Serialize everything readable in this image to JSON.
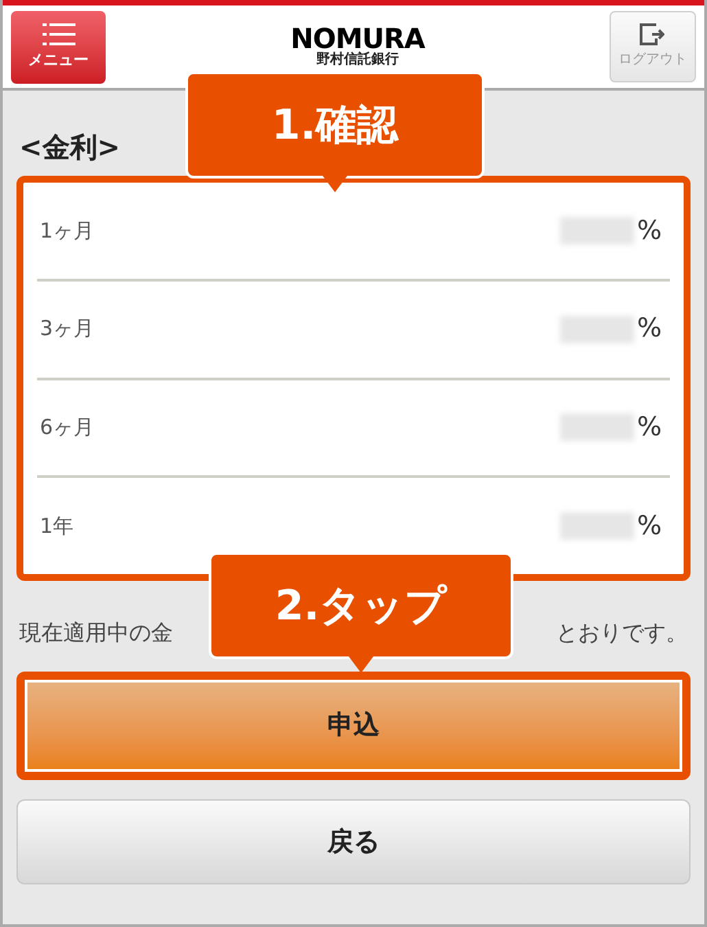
{
  "header": {
    "menu_button": "メニュー",
    "logo": "NOMURA",
    "logo_subtitle": "野村信託銀行",
    "logout_button": "ログアウト"
  },
  "section_title": "<金利>",
  "rates": [
    {
      "term": "1ヶ月",
      "unit": "%"
    },
    {
      "term": "3ヶ月",
      "unit": "%"
    },
    {
      "term": "6ヶ月",
      "unit": "%"
    },
    {
      "term": "1年",
      "unit": "%"
    }
  ],
  "notice": {
    "before": "現在適用中の金",
    "after": "とおりです。"
  },
  "buttons": [
    {
      "label": "申込",
      "kind": "primary",
      "highlighted": true
    },
    {
      "label": "戻る",
      "kind": "secondary",
      "highlighted": false
    }
  ],
  "callouts": [
    {
      "label": "1.確認"
    },
    {
      "label": "2.タップ"
    }
  ]
}
